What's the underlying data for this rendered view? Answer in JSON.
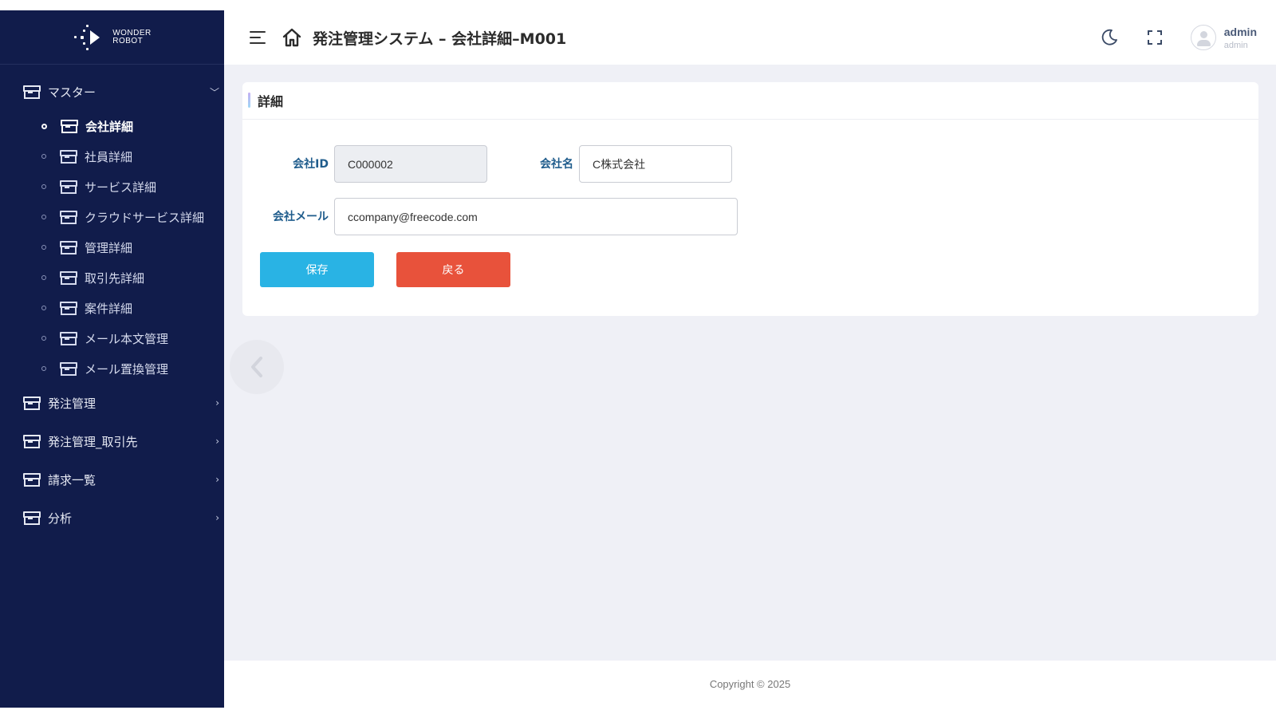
{
  "brand": {
    "logo_line1": "WONDER",
    "logo_line2": "ROBOT"
  },
  "sidebar": {
    "groups": [
      {
        "label": "マスター",
        "expanded": true
      },
      {
        "label": "発注管理",
        "expanded": false
      },
      {
        "label": "発注管理_取引先",
        "expanded": false
      },
      {
        "label": "請求一覧",
        "expanded": false
      },
      {
        "label": "分析",
        "expanded": false
      }
    ],
    "master_items": [
      {
        "label": "会社詳細",
        "active": true
      },
      {
        "label": "社員詳細"
      },
      {
        "label": "サービス詳細"
      },
      {
        "label": "クラウドサービス詳細"
      },
      {
        "label": "管理詳細"
      },
      {
        "label": "取引先詳細"
      },
      {
        "label": "案件詳細"
      },
      {
        "label": "メール本文管理"
      },
      {
        "label": "メール置換管理"
      }
    ]
  },
  "header": {
    "title": "発注管理システム – 会社詳細–M001",
    "user_name": "admin",
    "user_role": "admin",
    "icons": [
      "menu-icon",
      "home-icon",
      "moon-icon",
      "fullscreen-icon",
      "avatar-icon"
    ]
  },
  "card": {
    "title": "詳細",
    "company_id_label": "会社ID",
    "company_id_value": "C000002",
    "company_name_label": "会社名",
    "company_name_value": "C株式会社",
    "company_mail_label": "会社メール",
    "company_mail_value": "ccompany@freecode.com",
    "save_label": "保存",
    "back_label": "戻る"
  },
  "footer": {
    "copyright": "Copyright © 2025"
  },
  "colors": {
    "sidebar_bg": "#111c4b",
    "label": "#1f5c8c",
    "save": "#29b3e4",
    "back": "#e8523b",
    "main_bg": "#eff0f6"
  }
}
